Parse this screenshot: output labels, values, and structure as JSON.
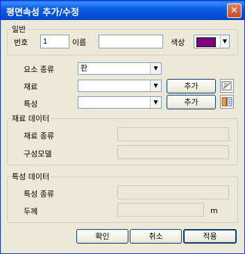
{
  "window": {
    "title": "평면속성 추가/수정",
    "close_label": "✕"
  },
  "general": {
    "legend": "일반",
    "number_label": "번호",
    "number_value": "1",
    "name_label": "이름",
    "name_value": "",
    "color_label": "색상",
    "color_value": "#800080"
  },
  "element_type": {
    "label": "요소 종류",
    "value": "판"
  },
  "material": {
    "label": "재료",
    "value": "",
    "add_label": "추가"
  },
  "property": {
    "label": "특성",
    "value": "",
    "add_label": "추가"
  },
  "material_data": {
    "legend": "재료 데이터",
    "type_label": "재료 종류",
    "model_label": "구성모델"
  },
  "property_data": {
    "legend": "특성 데이터",
    "type_label": "특성 종류",
    "thickness_label": "두께",
    "thickness_unit": "m"
  },
  "buttons": {
    "ok": "확인",
    "cancel": "취소",
    "apply": "적용"
  }
}
